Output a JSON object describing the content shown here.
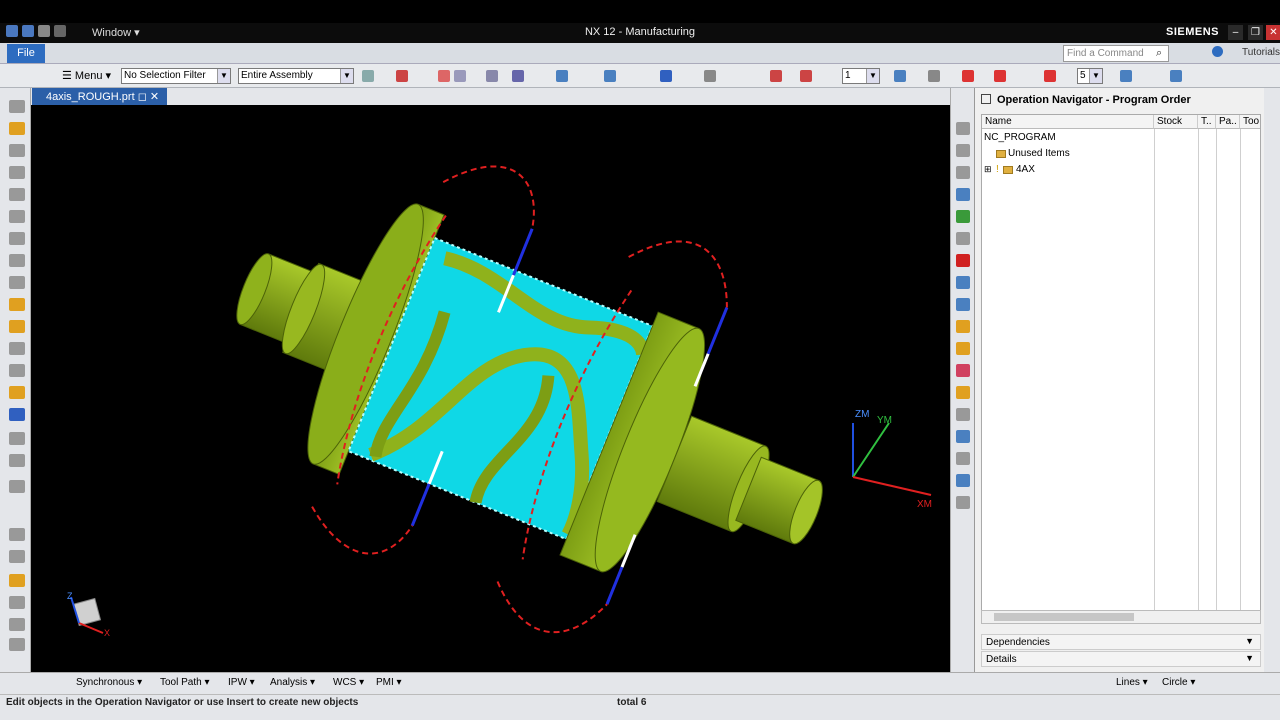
{
  "titlebar": {
    "window_menu": "Window",
    "title": "NX 12 - Manufacturing",
    "brand": "SIEMENS"
  },
  "ribbon": {
    "file_tab": "File",
    "find_placeholder": "Find a Command",
    "tutorials": "Tutorials"
  },
  "toolbar": {
    "menu": "Menu",
    "selection_filter": "No Selection Filter",
    "assembly_scope": "Entire Assembly",
    "level_value": "1",
    "count_value": "5"
  },
  "document": {
    "tab_label": "4axis_ROUGH.prt"
  },
  "viewport": {
    "axis_labels": {
      "zm": "ZM",
      "ym": "YM",
      "xm": "XM"
    },
    "triad_labels": {
      "x": "X",
      "z": "Z"
    }
  },
  "navigator": {
    "title": "Operation Navigator - Program Order",
    "columns": [
      "Name",
      "Stock",
      "T..",
      "Pa..",
      "Too"
    ],
    "rows": [
      {
        "name": "NC_PROGRAM",
        "level": 0
      },
      {
        "name": "Unused Items",
        "level": 1
      },
      {
        "name": "4AX",
        "level": 1
      }
    ],
    "sections": [
      "Dependencies",
      "Details"
    ]
  },
  "bottombar": {
    "synchronous": "Synchronous",
    "tool_path": "Tool Path",
    "ipw": "IPW",
    "analysis": "Analysis",
    "wcs": "WCS",
    "pmi": "PMI",
    "lines": "Lines",
    "circle": "Circle"
  },
  "status": {
    "message": "Edit objects in the Operation Navigator or use Insert to create new objects",
    "total": "total 6"
  },
  "colors": {
    "part_green": "#9bbf1e",
    "toolpath_cyan": "#11e6f0",
    "rapid_red": "#e02020",
    "file_blue": "#2d6cc0",
    "viewport_bg": "#000000"
  }
}
